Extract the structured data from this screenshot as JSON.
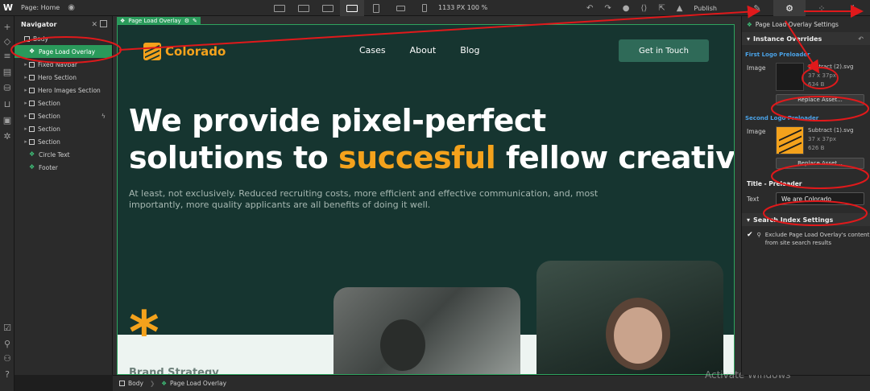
{
  "topbar": {
    "logo": "W",
    "page_label": "Page: Home",
    "canvas_size": "1133 PX  100 %",
    "publish_label": "Publish"
  },
  "navigator": {
    "title": "Navigator",
    "items": [
      {
        "label": "Body",
        "kind": "box",
        "indent": 0
      },
      {
        "label": "Page Load Overlay",
        "kind": "component",
        "indent": 1,
        "selected": true
      },
      {
        "label": "Fixed Navbar",
        "kind": "box",
        "indent": 1
      },
      {
        "label": "Hero Section",
        "kind": "box",
        "indent": 1
      },
      {
        "label": "Hero Images Section",
        "kind": "box",
        "indent": 1
      },
      {
        "label": "Section",
        "kind": "box",
        "indent": 1
      },
      {
        "label": "Section",
        "kind": "box",
        "indent": 1
      },
      {
        "label": "Section",
        "kind": "box",
        "indent": 1
      },
      {
        "label": "Section",
        "kind": "box",
        "indent": 1
      },
      {
        "label": "Circle Text",
        "kind": "component",
        "indent": 1
      },
      {
        "label": "Footer",
        "kind": "component",
        "indent": 1
      }
    ]
  },
  "canvas": {
    "selection_label": "Page Load Overlay",
    "logo_text": "Colorado",
    "menu": [
      "Cases",
      "About",
      "Blog"
    ],
    "cta": "Get in Touch",
    "headline_line1": "We provide pixel-perfect",
    "headline_line2_a": "solutions to ",
    "headline_highlight": "succesful",
    "headline_line2_b": " fellow creatives",
    "paragraph": "At least, not exclusively. Reduced recruiting costs, more efficient and effective communication, and, most importantly, more quality applicants are all benefits of doing it well.",
    "star": "*",
    "brand_strategy": "Brand Strategy",
    "accent_color": "#f4a21c",
    "background_color": "#163530"
  },
  "breadcrumb": [
    "Body",
    "Page Load Overlay"
  ],
  "watermark": "Activate Windows",
  "panel": {
    "title": "Page Load Overlay Settings",
    "section_overrides": "Instance Overrides",
    "first_logo": {
      "group": "First Logo Preloader",
      "label": "Image",
      "file": "Subtract (2).svg",
      "dims": "37 x 37px",
      "size": "634 B",
      "button": "Replace Asset..."
    },
    "second_logo": {
      "group": "Second Logo Preloader",
      "label": "Image",
      "file": "Subtract (1).svg",
      "dims": "37 x 37px",
      "size": "626 B",
      "button": "Replace Asset..."
    },
    "title_preloader": {
      "heading": "Title - Preloader",
      "label": "Text",
      "value": "We are Colorado"
    },
    "section_search": "Search Index Settings",
    "exclude_text": "Exclude Page Load Overlay's content from site search results"
  }
}
